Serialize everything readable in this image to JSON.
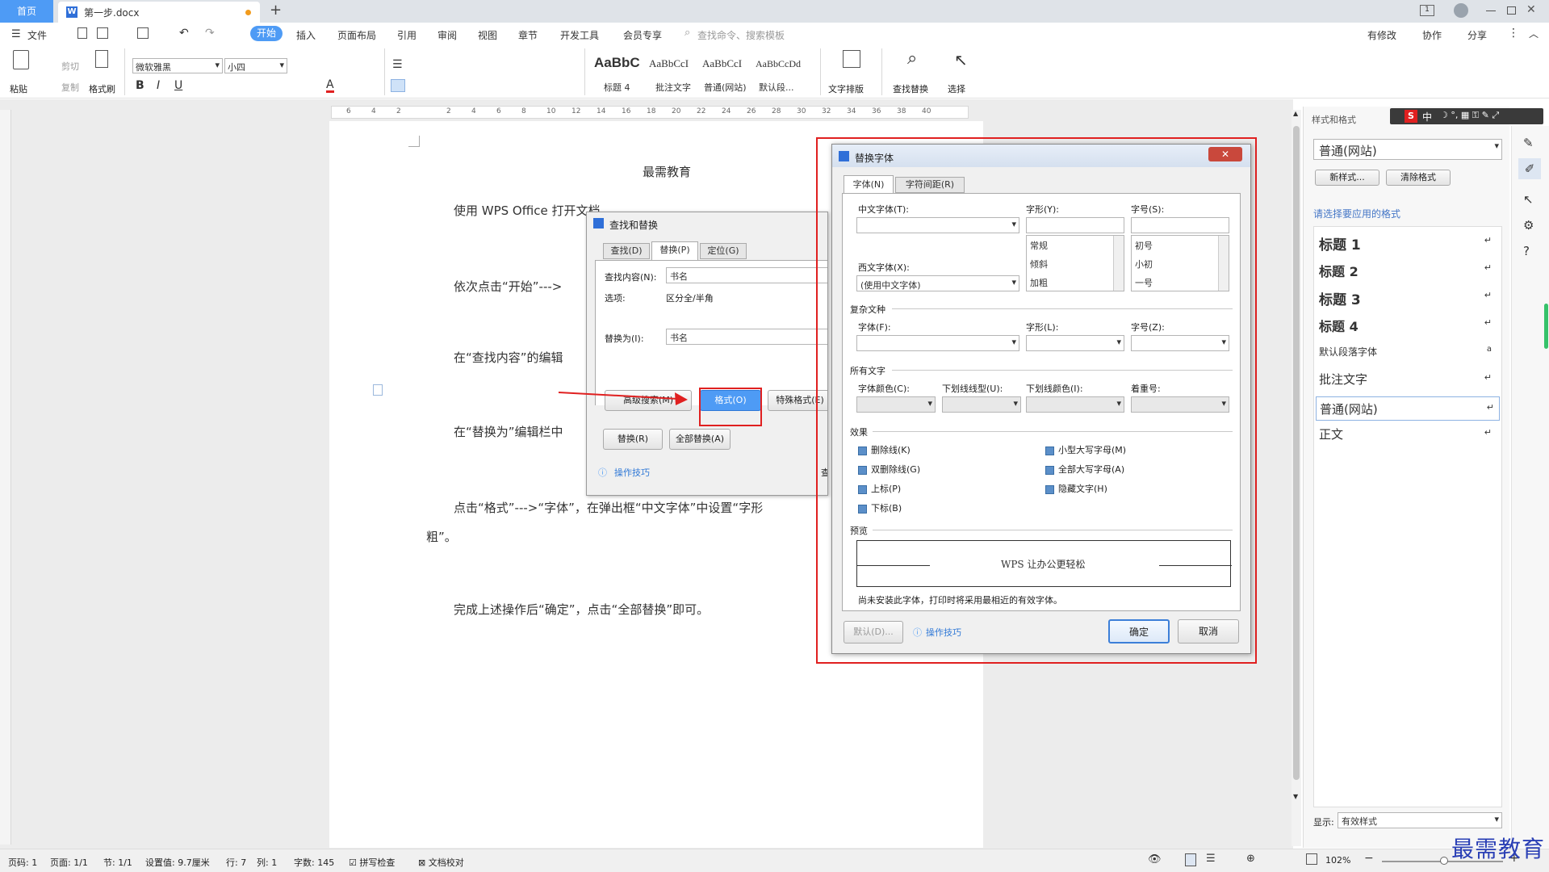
{
  "tabbar": {
    "home_tab": "首页",
    "doc_tab": "第一步.docx",
    "new_tab": "+"
  },
  "menubar": {
    "file": "文件",
    "tabs": [
      "开始",
      "插入",
      "页面布局",
      "引用",
      "审阅",
      "视图",
      "章节",
      "开发工具",
      "会员专享"
    ],
    "search_placeholder": "查找命令、搜索模板",
    "right": [
      "有修改",
      "协作",
      "分享"
    ]
  },
  "ribbon": {
    "paste": "粘贴",
    "cut": "剪切",
    "copy": "复制",
    "format_painter": "格式刷",
    "font_name": "微软雅黑",
    "font_size": "小四",
    "styles": [
      {
        "sample": "AaBbC",
        "name": "标题 4"
      },
      {
        "sample": "AaBbCcI",
        "name": "批注文字"
      },
      {
        "sample": "AaBbCcI",
        "name": "普通(网站)"
      },
      {
        "sample": "AaBbCcDd",
        "name": "默认段..."
      }
    ],
    "text_layout": "文字排版",
    "find_replace": "查找替换",
    "select": "选择"
  },
  "document": {
    "ruler_numbers": [
      "6",
      "4",
      "2",
      "",
      "2",
      "4",
      "6",
      "8",
      "10",
      "12",
      "14",
      "16",
      "18",
      "20",
      "22",
      "24",
      "26",
      "28",
      "30",
      "32",
      "34",
      "36",
      "38",
      "40"
    ],
    "title": "最需教育",
    "paragraphs": [
      "使用 WPS Office 打开文档",
      "依次点击“开始”--->",
      "在“查找内容”的编辑",
      "在“替换为”编辑栏中",
      "点击“格式”--->“字体”，在弹出框“中文字体”中设置“字形",
      "粗”。",
      "完成上述操作后“确定”，点击“全部替换”即可。"
    ]
  },
  "find_dialog": {
    "title": "查找和替换",
    "tabs": [
      "查找(D)",
      "替换(P)",
      "定位(G)"
    ],
    "find_label": "查找内容(N):",
    "find_value": "书名",
    "options_label": "选项:",
    "options_value": "区分全/半角",
    "replace_label": "替换为(I):",
    "replace_value": "书名",
    "btn_advanced": "高级搜索(M)",
    "btn_format": "格式(O)",
    "btn_special": "特殊格式(E)",
    "btn_replace": "替换(R)",
    "btn_replace_all": "全部替换(A)",
    "tips": "操作技巧",
    "cut_text": "查"
  },
  "font_dialog": {
    "title": "替换字体",
    "tabs": [
      "字体(N)",
      "字符间距(R)"
    ],
    "cn_font_label": "中文字体(T):",
    "style_label": "字形(Y):",
    "size_label": "字号(S):",
    "west_font_label": "西文字体(X):",
    "west_font_value": "(使用中文字体)",
    "style_options": [
      "常规",
      "倾斜",
      "加粗"
    ],
    "size_options": [
      "初号",
      "小初",
      "一号"
    ],
    "complex_section": "复杂文种",
    "complex_font_label": "字体(F):",
    "complex_style_label": "字形(L):",
    "complex_size_label": "字号(Z):",
    "all_text_section": "所有文字",
    "font_color_label": "字体颜色(C):",
    "underline_type_label": "下划线线型(U):",
    "underline_color_label": "下划线颜色(I):",
    "emphasis_label": "着重号:",
    "effects_section": "效果",
    "effects_left": [
      "删除线(K)",
      "双删除线(G)",
      "上标(P)",
      "下标(B)"
    ],
    "effects_right": [
      "小型大写字母(M)",
      "全部大写字母(A)",
      "隐藏文字(H)"
    ],
    "preview_section": "预览",
    "preview_text": "WPS 让办公更轻松",
    "preview_note": "尚未安装此字体，打印时将采用最相近的有效字体。",
    "btn_default": "默认(D)...",
    "tips": "操作技巧",
    "btn_ok": "确定",
    "btn_cancel": "取消"
  },
  "style_pane": {
    "header": "样式和格式",
    "current_style": "普通(网站)",
    "btn_new": "新样式...",
    "btn_clear": "清除格式",
    "apply_label": "请选择要应用的格式",
    "items": [
      "标题 1",
      "标题 2",
      "标题 3",
      "标题 4",
      "默认段落字体",
      "批注文字",
      "普通(网站)",
      "正文"
    ],
    "show_label": "显示:",
    "show_value": "有效样式"
  },
  "ime_bar": {
    "logo": "S",
    "mode": "中"
  },
  "statusbar": {
    "items": [
      "页码: 1",
      "页面: 1/1",
      "节: 1/1",
      "设置值: 9.7厘米",
      "行: 7",
      "列: 1",
      "字数: 145",
      "拼写检查",
      "文档校对"
    ],
    "zoom": "102%"
  },
  "watermark": "最需教育",
  "colors": {
    "accent": "#4e9bf5",
    "highlight": "#e02020",
    "tabbar": "#dfe3e8"
  }
}
